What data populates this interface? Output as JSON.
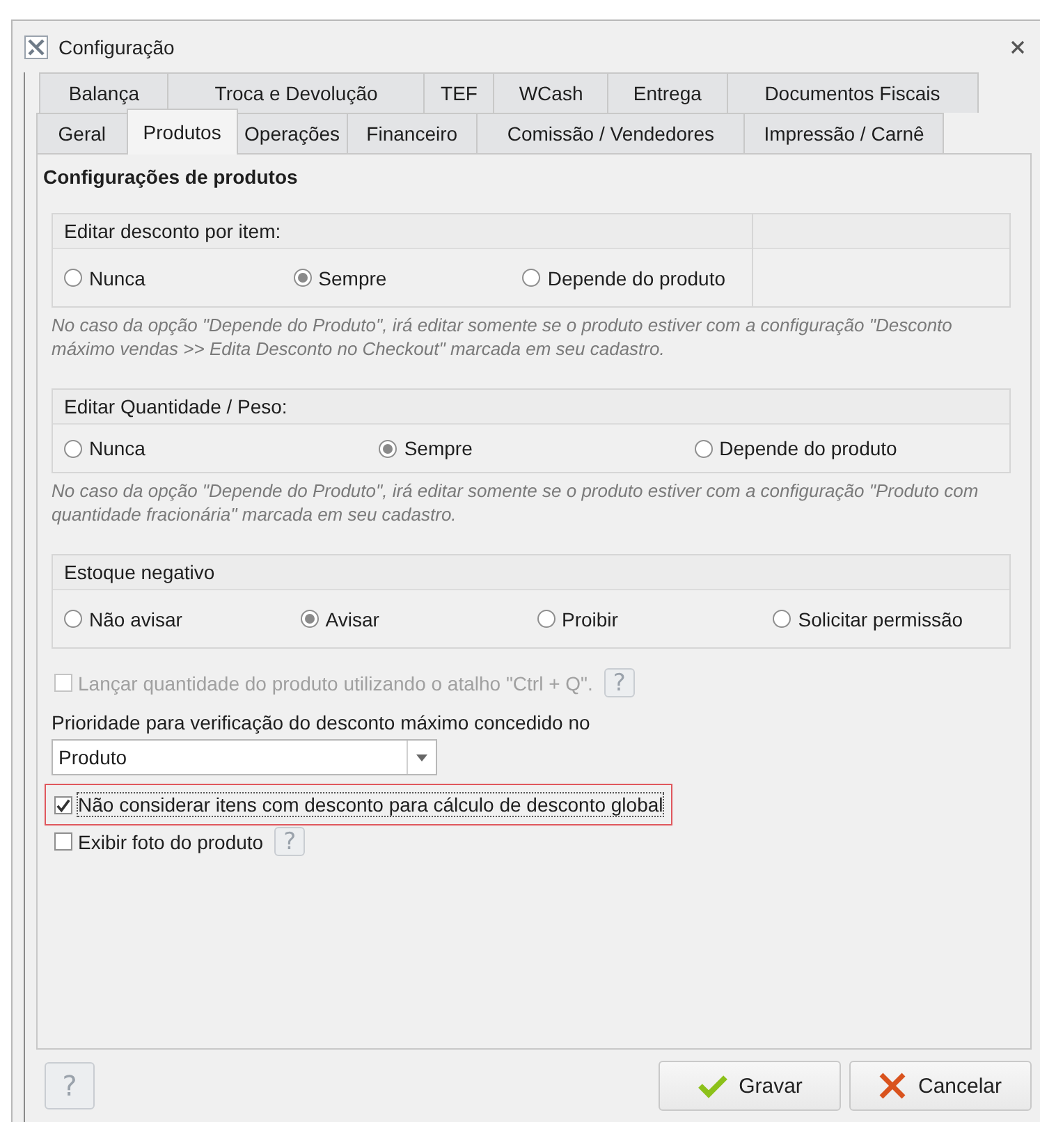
{
  "window": {
    "title": "Configuração"
  },
  "tab_rows": [
    [
      {
        "label": "Balança",
        "selected": false
      },
      {
        "label": "Troca e Devolução",
        "selected": false
      },
      {
        "label": "TEF",
        "selected": false
      },
      {
        "label": "WCash",
        "selected": false
      },
      {
        "label": "Entrega",
        "selected": false
      },
      {
        "label": "Documentos Fiscais",
        "selected": false
      }
    ],
    [
      {
        "label": "Geral",
        "selected": false
      },
      {
        "label": "Produtos",
        "selected": true
      },
      {
        "label": "Operações",
        "selected": false
      },
      {
        "label": "Financeiro",
        "selected": false
      },
      {
        "label": "Comissão / Vendedores",
        "selected": false
      },
      {
        "label": "Impressão / Carnê",
        "selected": false
      }
    ]
  ],
  "section_title": "Configurações de produtos",
  "groups": [
    {
      "title": "Editar desconto por item:",
      "side_column": true,
      "options": [
        {
          "label": "Nunca",
          "selected": false
        },
        {
          "label": "Sempre",
          "selected": true
        },
        {
          "label": "Depende do produto",
          "selected": false
        }
      ],
      "note": "No caso da opção \"Depende do Produto\", irá editar somente se o produto estiver com a configuração \"Desconto máximo vendas >> Edita Desconto no Checkout\" marcada em seu cadastro."
    },
    {
      "title": "Editar Quantidade / Peso:",
      "side_column": false,
      "options": [
        {
          "label": "Nunca",
          "selected": false
        },
        {
          "label": "Sempre",
          "selected": true
        },
        {
          "label": "Depende do produto",
          "selected": false
        }
      ],
      "note": "No caso da opção \"Depende do Produto\", irá editar somente se o produto estiver com a configuração \"Produto com quantidade fracionária\" marcada em seu cadastro."
    },
    {
      "title": "Estoque negativo",
      "side_column": false,
      "options": [
        {
          "label": "Não avisar",
          "selected": false
        },
        {
          "label": "Avisar",
          "selected": true
        },
        {
          "label": "Proibir",
          "selected": false
        },
        {
          "label": "Solicitar permissão",
          "selected": false
        }
      ]
    }
  ],
  "shortcut_option": {
    "label": "Lançar quantidade do produto utilizando o atalho \"Ctrl + Q\".",
    "checked": false,
    "disabled": true,
    "help": "?"
  },
  "priority": {
    "label": "Prioridade para verificação do desconto máximo concedido no",
    "value": "Produto"
  },
  "options": [
    {
      "label": "Não considerar itens com desconto para cálculo de desconto global",
      "checked": true,
      "highlighted": true
    },
    {
      "label": "Exibir foto do produto",
      "checked": false,
      "highlighted": false,
      "help": "?"
    }
  ],
  "footer": {
    "help": "?",
    "buttons": [
      {
        "kind": "save",
        "label": "Gravar"
      },
      {
        "kind": "cancel",
        "label": "Cancelar"
      }
    ]
  }
}
